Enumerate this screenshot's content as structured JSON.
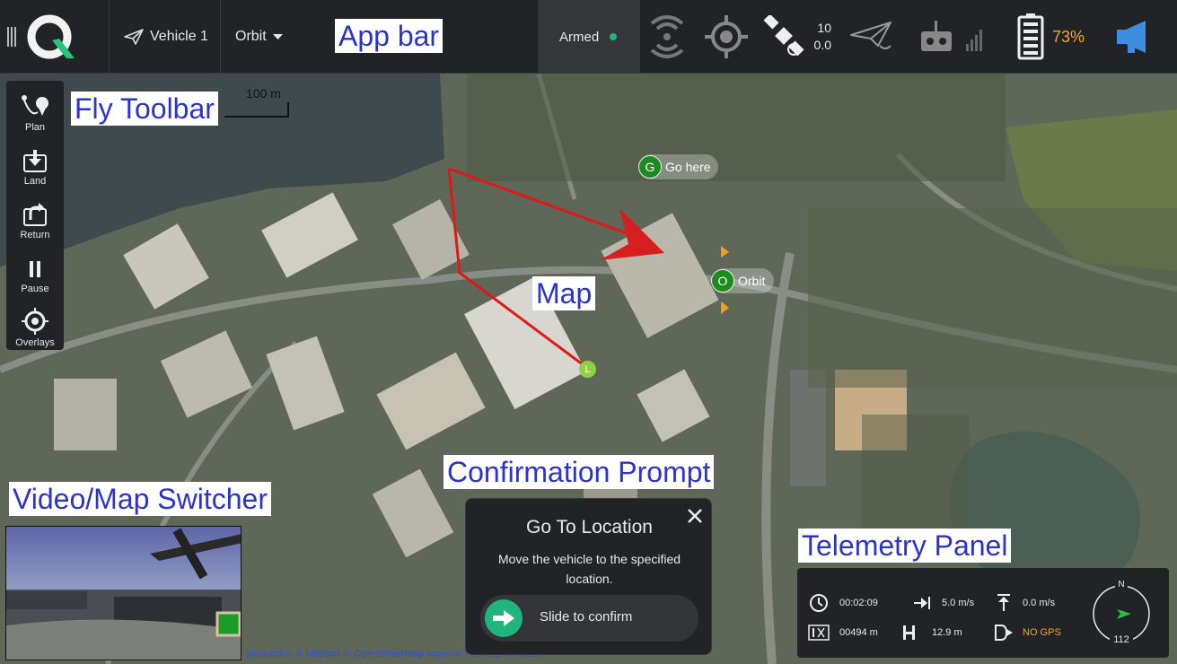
{
  "appbar": {
    "vehicle": "Vehicle 1",
    "mode": "Orbit",
    "status": "Armed",
    "satellites": "10",
    "hdop": "0.0",
    "battery": "73%",
    "colors": {
      "battery": "#f0a830",
      "armed_dot": "#1fb57d",
      "announce": "#3d8ee0"
    }
  },
  "labels": {
    "app_bar": "App bar",
    "fly_toolbar": "Fly Toolbar",
    "map": "Map",
    "confirmation_prompt": "Confirmation Prompt",
    "video_switcher": "Video/Map Switcher",
    "telemetry_panel": "Telemetry Panel"
  },
  "toolbar": {
    "items": [
      {
        "label": "Plan",
        "icon": "plan-icon"
      },
      {
        "label": "Land",
        "icon": "land-icon"
      },
      {
        "label": "Return",
        "icon": "return-icon"
      },
      {
        "label": "Pause",
        "icon": "pause-icon"
      },
      {
        "label": "Overlays",
        "icon": "overlays-icon"
      }
    ]
  },
  "map": {
    "scale": "100 m",
    "go_here": {
      "letter": "G",
      "label": "Go here"
    },
    "orbit": {
      "letter": "O",
      "label": "Orbit"
    },
    "launch": {
      "letter": "L"
    },
    "attribution": "production  © Mapbox © OpenStreetMap  Improve this map  © Maxar"
  },
  "confirm": {
    "title": "Go To Location",
    "message": "Move the vehicle to the specified location.",
    "slider_label": "Slide to confirm"
  },
  "telemetry": {
    "flight_time": "00:02:09",
    "horizontal_speed": "5.0 m/s",
    "vertical_speed": "0.0 m/s",
    "distance": "00494 m",
    "altitude": "12.9 m",
    "gps_status": "NO GPS",
    "compass_n": "N",
    "heading": "112"
  }
}
